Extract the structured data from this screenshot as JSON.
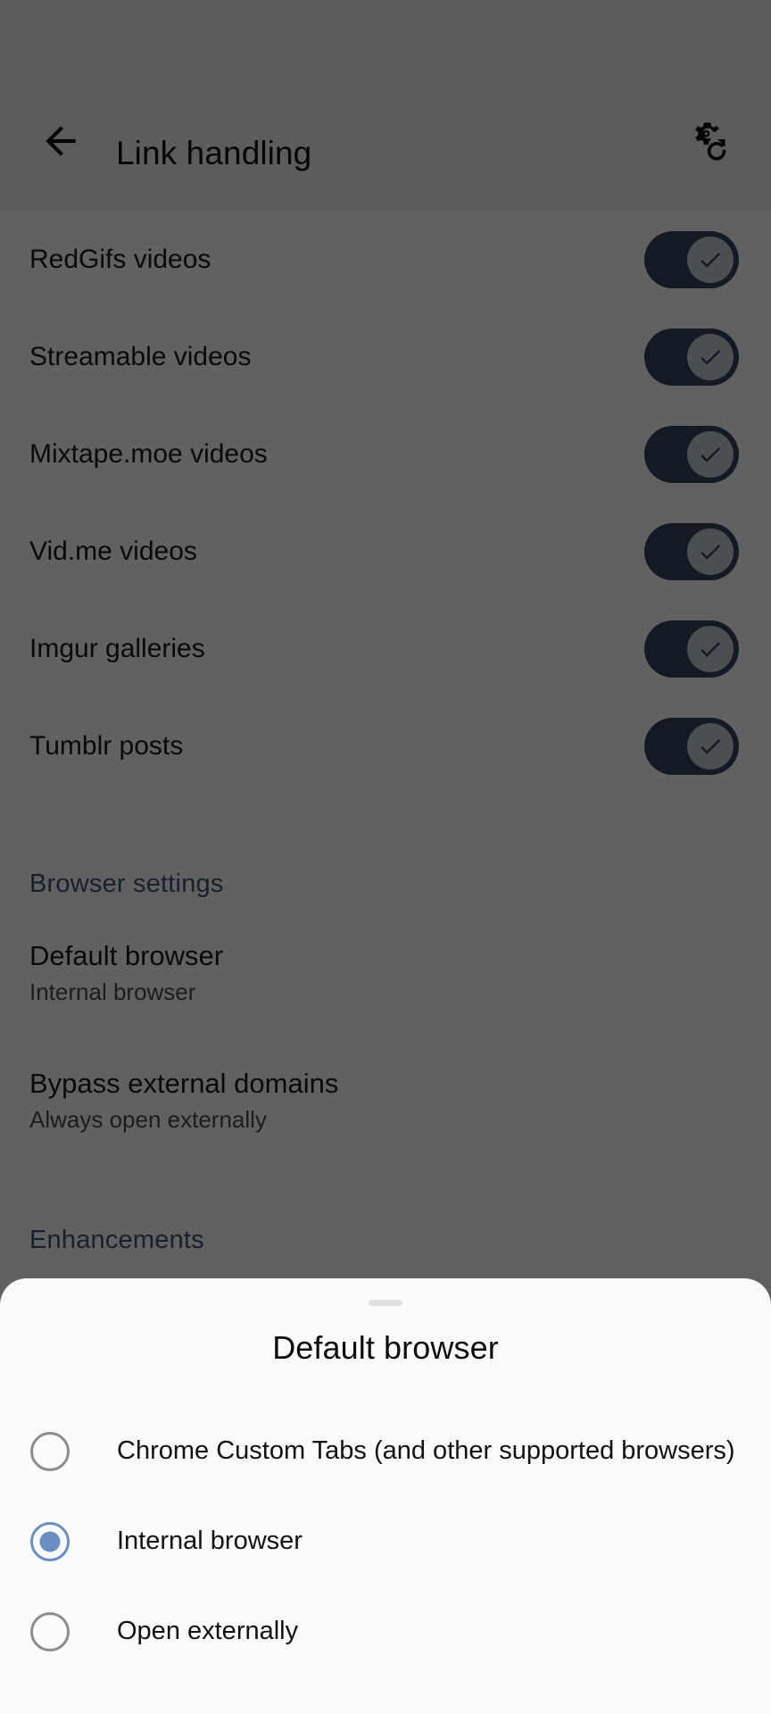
{
  "appbar": {
    "back_icon": "arrow-back-icon",
    "title": "Link handling",
    "action_icon": "settings-backup-restore-icon"
  },
  "content": {
    "link_rows": [
      {
        "label": "RedGifs videos",
        "enabled": true
      },
      {
        "label": "Streamable videos",
        "enabled": true
      },
      {
        "label": "Mixtape.moe videos",
        "enabled": true
      },
      {
        "label": "Vid.me videos",
        "enabled": true
      },
      {
        "label": "Imgur galleries",
        "enabled": true
      },
      {
        "label": "Tumblr posts",
        "enabled": true
      }
    ],
    "browser_settings_header": "Browser settings",
    "default_browser": {
      "title": "Default browser",
      "subtitle": "Internal browser"
    },
    "bypass_domains": {
      "title": "Bypass external domains",
      "subtitle": "Always open externally"
    },
    "enhancements_header": "Enhancements"
  },
  "sheet": {
    "handle": "drag-handle",
    "title": "Default browser",
    "options": [
      {
        "label": "Chrome Custom Tabs (and other supported browsers)",
        "selected": false
      },
      {
        "label": "Internal browser",
        "selected": true
      },
      {
        "label": "Open externally",
        "selected": false
      }
    ]
  },
  "colors": {
    "accent_blue": "#6b8ec2",
    "switch_track_on": "#36455c",
    "switch_thumb": "#c9cfd6",
    "section_header": "#3f5573",
    "sheet_bg": "#fafbfd",
    "scrim": "rgba(0,0,0,0.62)"
  }
}
